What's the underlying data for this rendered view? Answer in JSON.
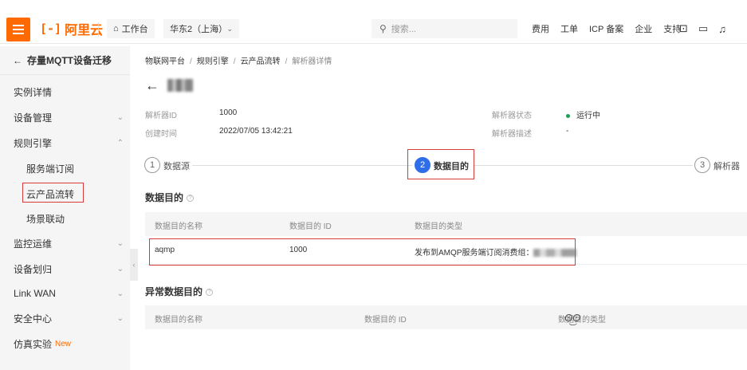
{
  "topbar": {
    "logo_text": "阿里云",
    "logo_mark": "[-]",
    "workbench_label": "工作台",
    "region_label": "华东2（上海）",
    "search_placeholder": "搜索...",
    "nav": [
      "费用",
      "工单",
      "ICP 备案",
      "企业",
      "支持"
    ]
  },
  "sidebar": {
    "back_label": "存量MQTT设备迁移",
    "items": [
      {
        "label": "实例详情"
      },
      {
        "label": "设备管理"
      },
      {
        "label": "规则引擎"
      },
      {
        "label": "服务端订阅"
      },
      {
        "label": "云产品流转"
      },
      {
        "label": "场景联动"
      },
      {
        "label": "监控运维"
      },
      {
        "label": "设备划归"
      },
      {
        "label": "Link WAN"
      },
      {
        "label": "安全中心"
      },
      {
        "label": "仿真实验",
        "badge": "New"
      }
    ]
  },
  "breadcrumb": [
    "物联网平台",
    "规则引擎",
    "云产品流转",
    "解析器详情"
  ],
  "meta": {
    "id_label": "解析器ID",
    "id_value": "1000",
    "created_label": "创建时间",
    "created_value": "2022/07/05 13:42:21",
    "status_label": "解析器状态",
    "status_value": "运行中",
    "desc_label": "解析器描述",
    "desc_value": "-"
  },
  "steps": [
    {
      "num": "1",
      "label": "数据源"
    },
    {
      "num": "2",
      "label": "数据目的"
    },
    {
      "num": "3",
      "label": "解析器"
    }
  ],
  "destination": {
    "title": "数据目的",
    "headers": [
      "数据目的名称",
      "数据目的 ID",
      "数据目的类型"
    ],
    "row": {
      "name": "aqmp",
      "id": "1000",
      "type": "发布到AMQP服务端订阅消费组："
    }
  },
  "error_destination": {
    "title": "异常数据目的",
    "headers": [
      "数据目的名称",
      "数据目的 ID",
      "数据目的类型"
    ]
  },
  "colors": {
    "brand": "#ff6a00",
    "active_step": "#2f6ee8",
    "highlight": "#d93a3a",
    "status_ok": "#1e9e54"
  }
}
